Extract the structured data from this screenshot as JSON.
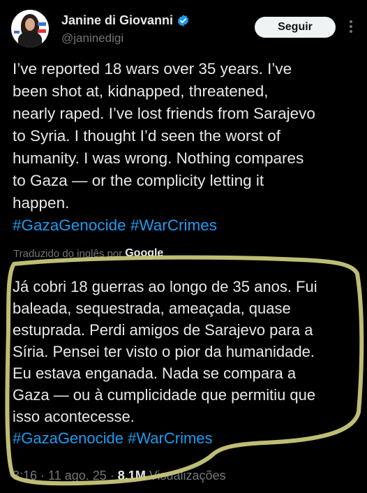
{
  "author": {
    "display_name": "Janine di Giovanni",
    "handle": "@janinedigi",
    "verified": true
  },
  "follow_button_label": "Seguir",
  "tweet": {
    "lines": [
      "I’ve reported 18 wars over 35 years. I’ve",
      "been shot at, kidnapped, threatened,",
      "nearly raped. I’ve lost friends from Sarajevo",
      "to Syria. I thought I’d seen the worst of",
      "humanity. I was wrong. Nothing compares",
      "to Gaza — or the complicity letting it",
      "happen."
    ],
    "hashtags": [
      "#GazaGenocide",
      "#WarCrimes"
    ]
  },
  "translation": {
    "label": "Traduzido do inglês por",
    "provider": "Google",
    "lines": [
      "Já cobri 18 guerras ao longo de 35 anos. Fui",
      "baleada, sequestrada, ameaçada, quase",
      "estuprada. Perdi amigos de Sarajevo para a",
      "Síria. Pensei ter visto o pior da humanidade.",
      "Eu estava enganada. Nada se compara a",
      "Gaza — ou à cumplicidade que permitiu que",
      "isso acontecesse."
    ],
    "hashtags": [
      "#GazaGenocide",
      "#WarCrimes"
    ]
  },
  "meta": {
    "time": "3:16",
    "date": "11 ago. 25",
    "views_count": "8,1M",
    "views_label": "Visualizações"
  },
  "colors": {
    "background": "#000000",
    "text": "#e7e9ea",
    "secondary": "#71767b",
    "link": "#1d9bf0",
    "verified": "#1d9bf0",
    "highlight": "#c8c77a"
  }
}
